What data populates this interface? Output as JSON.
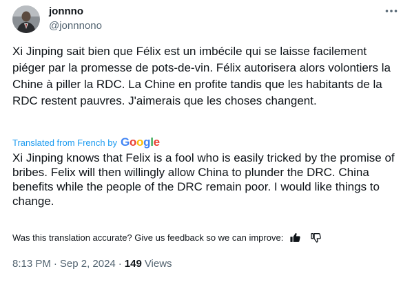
{
  "author": {
    "display_name": "jonnno",
    "handle": "@jonnnono"
  },
  "tweet": {
    "text": "Xi Jinping sait bien que Félix est un imbécile qui se laisse facilement piéger par la promesse de pots-de-vin. Félix autorisera alors volontiers la Chine à piller la RDC. La Chine en profite tandis que les habitants de la RDC restent pauvres. J'aimerais que les choses changent.",
    "translated_label": "Translated from French by",
    "translation_text": "Xi Jinping knows that Felix is a fool who is easily tricked by the promise of bribes. Felix will then willingly allow China to plunder the DRC. China benefits while the people of the DRC remain poor. I would like things to change.",
    "google_logo_letters": [
      "G",
      "o",
      "o",
      "g",
      "l",
      "e"
    ],
    "google_logo_colors": [
      "#4285F4",
      "#EA4335",
      "#FBBC05",
      "#4285F4",
      "#34A853",
      "#EA4335"
    ]
  },
  "feedback": {
    "prompt": "Was this translation accurate? Give us feedback so we can improve:",
    "thumbs_up_icon": "thumbs-up-icon",
    "thumbs_down_icon": "thumbs-down-icon"
  },
  "meta": {
    "time": "8:13 PM",
    "separator": "·",
    "date": "Sep 2, 2024",
    "views_count": "149",
    "views_label": "Views"
  },
  "colors": {
    "text": "#0f1419",
    "secondary": "#536471",
    "link": "#1d9bf0"
  },
  "icons": {
    "more": "more-horizontal-icon",
    "avatar": "avatar"
  }
}
